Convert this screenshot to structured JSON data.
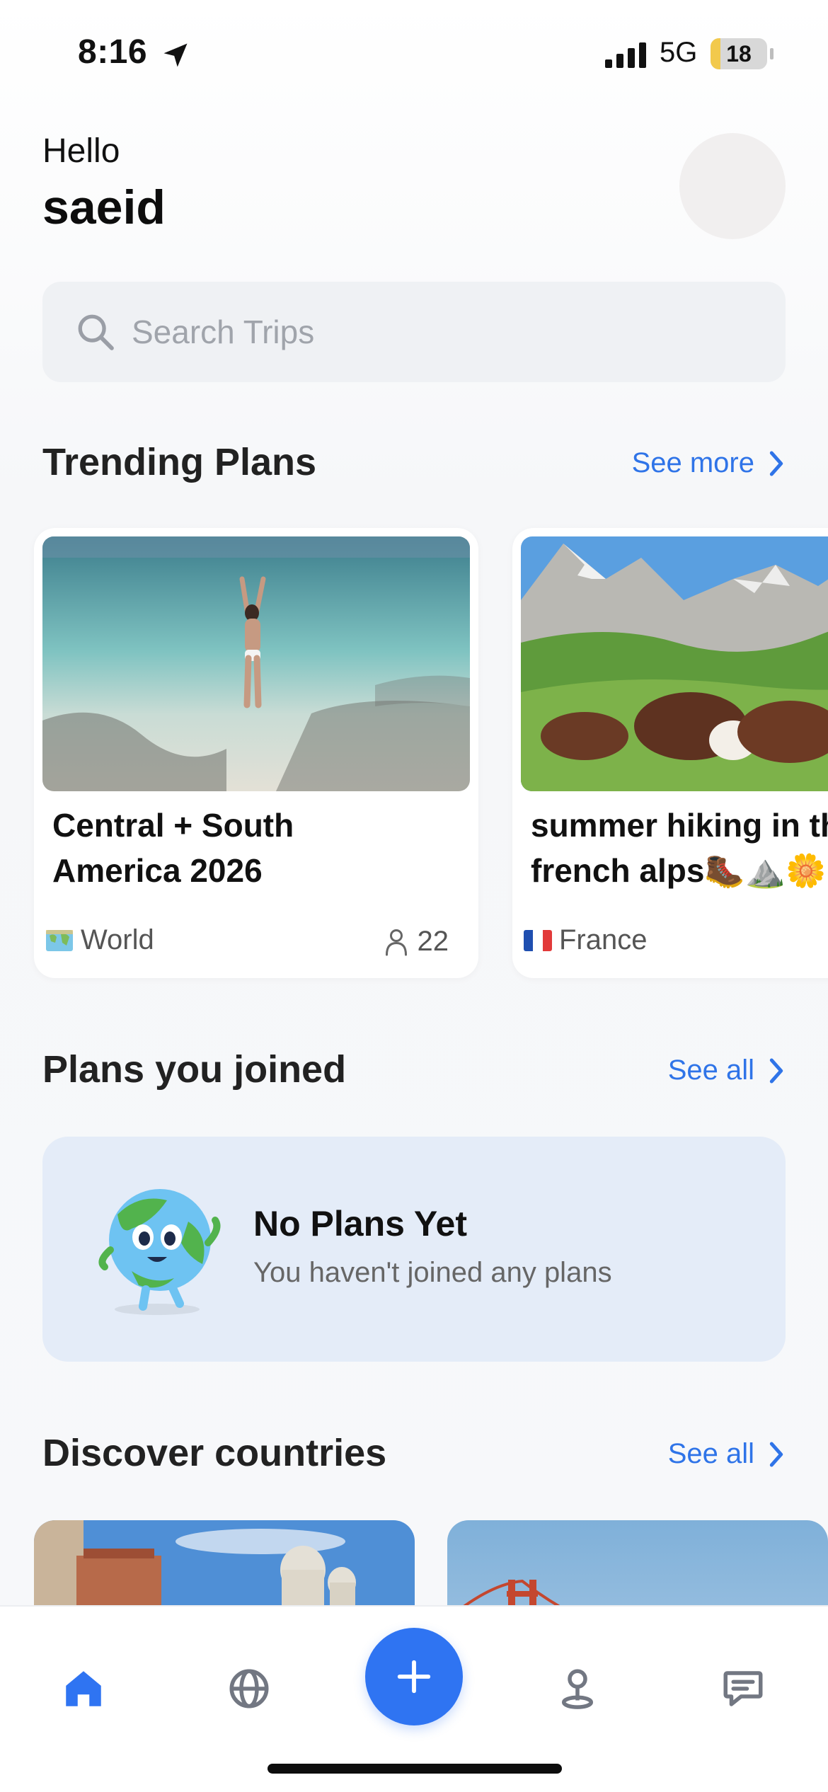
{
  "status_bar": {
    "time": "8:16",
    "network": "5G",
    "battery": "18",
    "battery_level": 0.18
  },
  "header": {
    "greeting": "Hello",
    "user_name": "saeid"
  },
  "search": {
    "placeholder": "Search Trips",
    "value": ""
  },
  "trending": {
    "title": "Trending Plans",
    "link_label": "See more",
    "cards": [
      {
        "title": "Central + South\nAmerica 2026",
        "location": "World",
        "location_icon": "world-map-icon",
        "members": "22"
      },
      {
        "title": "summer hiking in the\nfrench alps🥾⛰️🌼",
        "location": "France",
        "location_icon": "france-flag-icon",
        "members": ""
      }
    ]
  },
  "joined": {
    "title": "Plans you joined",
    "link_label": "See all",
    "empty_title": "No Plans Yet",
    "empty_subtitle": "You haven't joined any plans"
  },
  "discover": {
    "title": "Discover countries",
    "link_label": "See all"
  },
  "tabbar": {
    "items": [
      "home-icon",
      "globe-icon",
      "add-icon",
      "location-pin-icon",
      "chat-icon"
    ],
    "active": "home-icon"
  },
  "colors": {
    "accent": "#2f74f2",
    "link": "#2f74e8",
    "empty_state_bg": "#e4ecf8"
  }
}
